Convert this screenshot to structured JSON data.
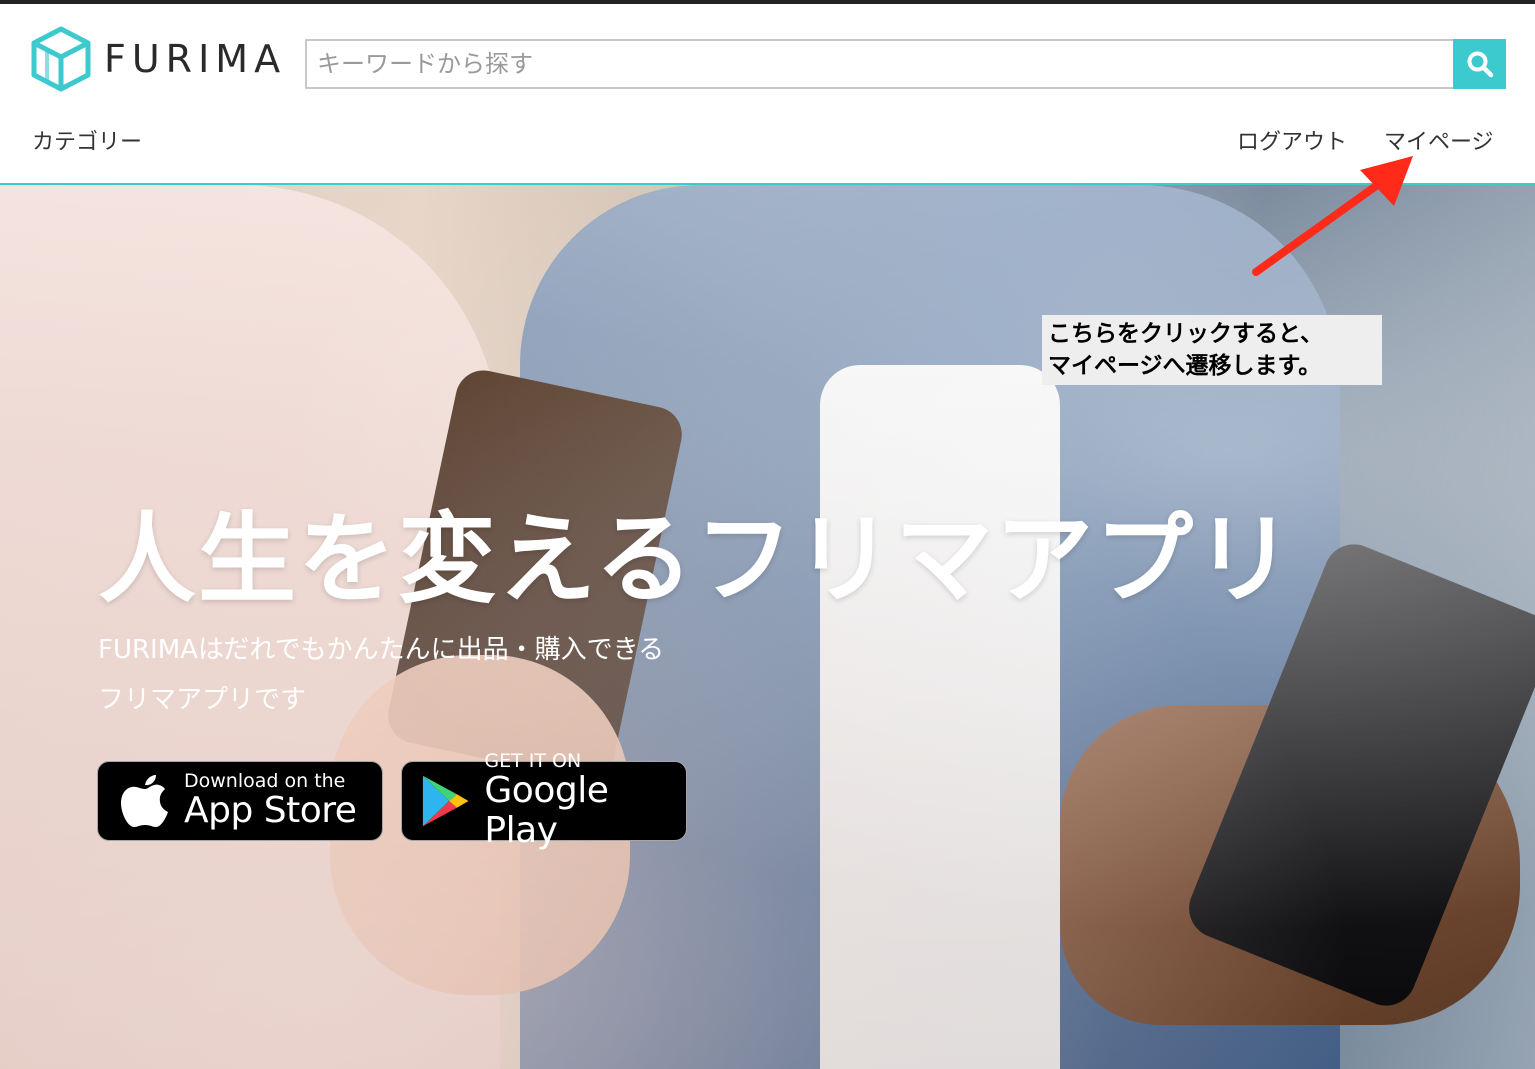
{
  "header": {
    "logo_text": "FURIMA",
    "search_placeholder": "キーワードから探す",
    "search_icon": "search-icon",
    "category_label": "カテゴリー",
    "logout_label": "ログアウト",
    "mypage_label": "マイページ"
  },
  "hero": {
    "title": "人生を変えるフリマアプリ",
    "subtitle_line1": "FURIMAはだれでもかんたんに出品・購入できる",
    "subtitle_line2": "フリマアプリです",
    "app_store": {
      "small": "Download on the",
      "big": "App Store"
    },
    "google_play": {
      "small": "GET IT ON",
      "big": "Google Play"
    }
  },
  "annotation": {
    "line1": "こちらをクリックすると、",
    "line2": "マイページへ遷移します。",
    "arrow_color": "#ff2a1a"
  },
  "colors": {
    "accent": "#3ccace",
    "text": "#333333"
  }
}
